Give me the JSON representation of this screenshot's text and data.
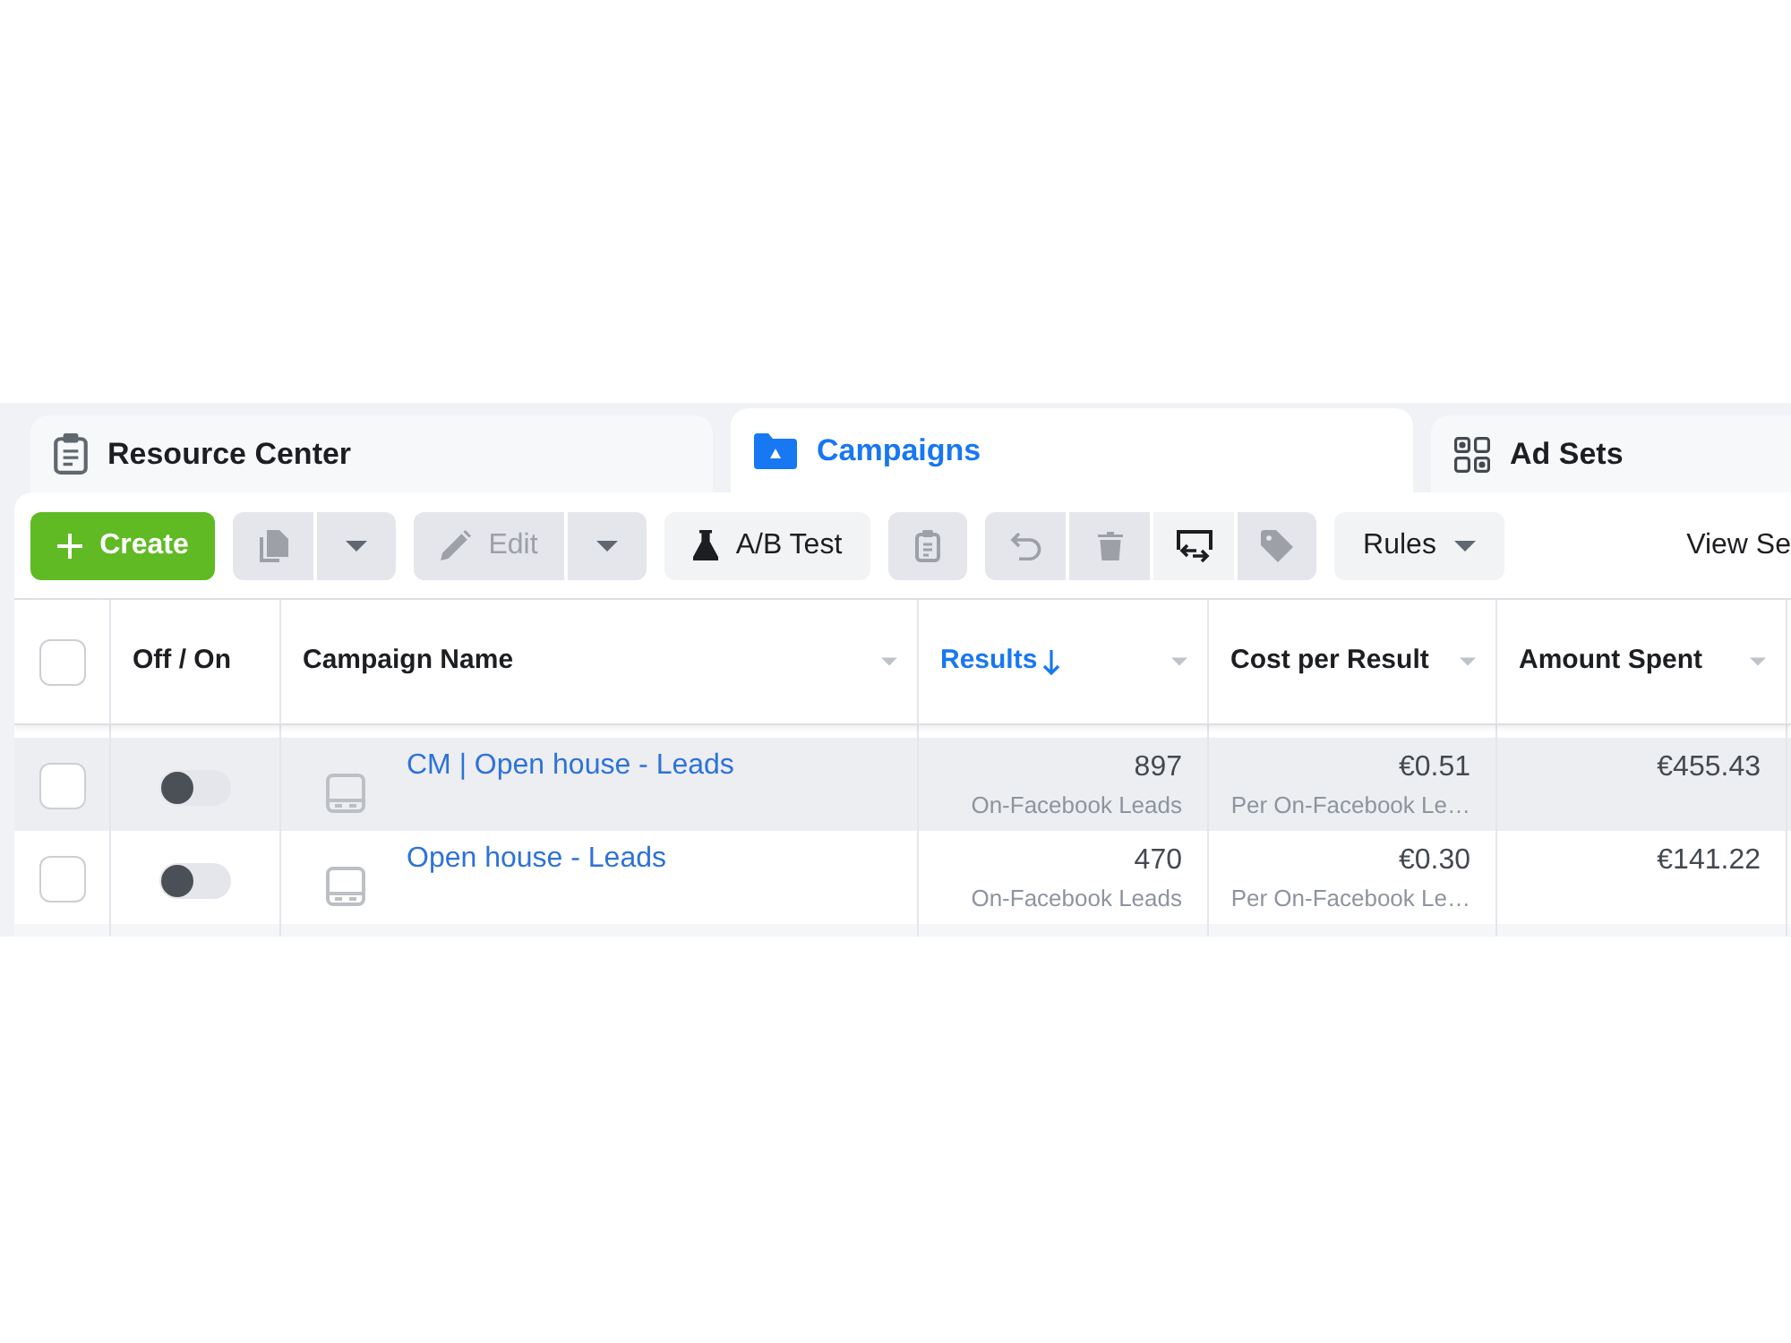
{
  "tabs": [
    {
      "label": "Resource Center",
      "selected": false
    },
    {
      "label": "Campaigns",
      "selected": true
    },
    {
      "label": "Ad Sets",
      "selected": false
    }
  ],
  "toolbar": {
    "groups": [
      {
        "buttons": [
          {
            "kind": "create",
            "label": "Create",
            "disabled": false
          }
        ]
      },
      {
        "buttons": [
          {
            "kind": "copy",
            "disabled": true
          },
          {
            "kind": "menu",
            "disabled": true
          }
        ]
      },
      {
        "buttons": [
          {
            "kind": "edit",
            "label": "Edit",
            "disabled": true
          },
          {
            "kind": "menu",
            "disabled": true
          }
        ]
      },
      {
        "buttons": [
          {
            "kind": "test",
            "label": "A/B Test",
            "disabled": false
          }
        ]
      },
      {
        "buttons": [
          {
            "kind": "paste",
            "disabled": true
          }
        ]
      },
      {
        "buttons": [
          {
            "kind": "undo",
            "disabled": true
          },
          {
            "kind": "delete",
            "disabled": true
          },
          {
            "kind": "swap",
            "disabled": false
          },
          {
            "kind": "tag",
            "disabled": true
          }
        ]
      },
      {
        "buttons": [
          {
            "kind": "rules",
            "label": "Rules",
            "disabled": false
          }
        ]
      }
    ],
    "view_link": "View Se"
  },
  "table": {
    "header_checkbox": {
      "checked": false
    },
    "columns": [
      {
        "label": "Off / On",
        "kind": "toggle",
        "sorted": false
      },
      {
        "label": "Campaign Name",
        "kind": "name",
        "sorted": false
      },
      {
        "label": "Results",
        "kind": "metric",
        "sorted": true
      },
      {
        "label": "Cost per Result",
        "kind": "metric",
        "sorted": false
      },
      {
        "label": "Amount Spent",
        "kind": "metric",
        "sorted": false
      }
    ],
    "rows": [
      {
        "highlighted": true,
        "checked": false,
        "on": false,
        "name": "CM | Open house - Leads",
        "results": "897",
        "results_note": "On-Facebook Leads",
        "cost": "€0.51",
        "cost_note": "Per On-Facebook Le…",
        "spent": "€455.43"
      },
      {
        "highlighted": false,
        "checked": false,
        "on": false,
        "name": "Open house - Leads",
        "results": "470",
        "results_note": "On-Facebook Leads",
        "cost": "€0.30",
        "cost_note": "Per On-Facebook Le…",
        "spent": "€141.22"
      }
    ]
  }
}
